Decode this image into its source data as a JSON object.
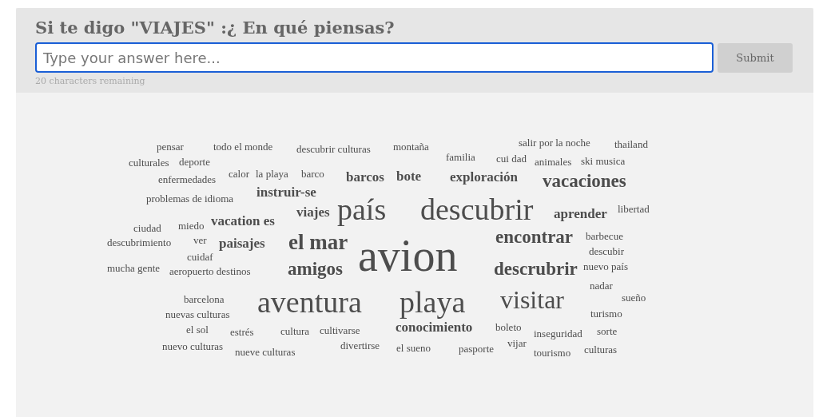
{
  "question": "Si te digo \"VIAJES\" :¿ En qué piensas?",
  "answer_field": {
    "placeholder": "Type your answer here..."
  },
  "submit_button": "Submit",
  "remaining": "20 characters remaining",
  "word_cloud": [
    "pensar",
    "todo el monde",
    "descubrir culturas",
    "montaña",
    "salir por la noche",
    "thailand",
    "culturales",
    "deporte",
    "familia",
    "cui dad",
    "animales",
    "ski musica",
    "enfermedades",
    "calor",
    "la playa",
    "barco",
    "barcos",
    "bote",
    "exploración",
    "vacaciones",
    "problemas de idioma",
    "instruir-se",
    "ciudad",
    "miedo",
    "vacation es",
    "viajes",
    "país",
    "descubrir",
    "aprender",
    "libertad",
    "descubrimiento",
    "ver",
    "paisajes",
    "el mar",
    "avion",
    "encontrar",
    "barbecue",
    "cuidaf",
    "descubir",
    "mucha gente",
    "aeropuerto destinos",
    "amigos",
    "descrubrir",
    "nuevo país",
    "nadar",
    "barcelona",
    "aventura",
    "playa",
    "visitar",
    "sueño",
    "nuevas culturas",
    "turismo",
    "el sol",
    "estrés",
    "cultura",
    "cultivarse",
    "conocimiento",
    "boleto",
    "inseguridad",
    "sorte",
    "nuevo culturas",
    "nueve culturas",
    "divertirse",
    "el sueno",
    "pasporte",
    "vijar",
    "tourismo",
    "culturas"
  ]
}
